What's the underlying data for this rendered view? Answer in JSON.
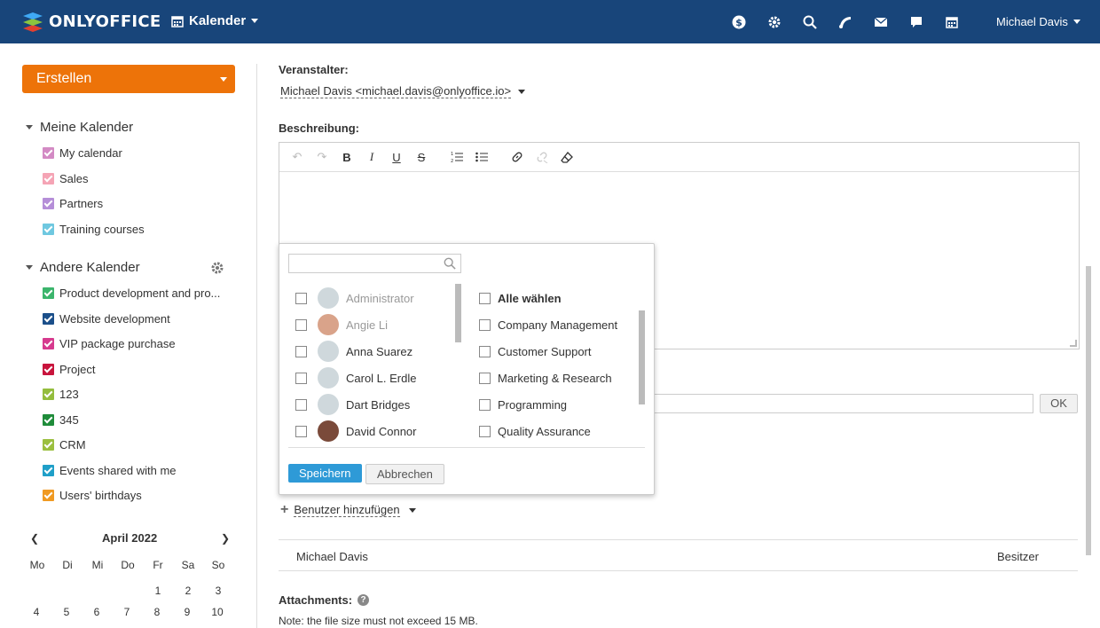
{
  "header": {
    "logo_text": "ONLYOFFICE",
    "module_label": "Kalender",
    "user_name": "Michael Davis",
    "icons": [
      "dollar-icon",
      "gear-icon",
      "search-icon",
      "feed-icon",
      "mail-icon",
      "chat-icon",
      "calendar-icon"
    ]
  },
  "sidebar": {
    "create_label": "Erstellen",
    "my_calendars_title": "Meine Kalender",
    "my_calendars": [
      {
        "label": "My calendar",
        "color": "#d38ac4"
      },
      {
        "label": "Sales",
        "color": "#f5a4b5"
      },
      {
        "label": "Partners",
        "color": "#b58ed8"
      },
      {
        "label": "Training courses",
        "color": "#6fc8e0"
      }
    ],
    "other_calendars_title": "Andere Kalender",
    "other_calendars": [
      {
        "label": "Product development and pro...",
        "color": "#3bb56c"
      },
      {
        "label": "Website development",
        "color": "#1b4f8a"
      },
      {
        "label": "VIP package purchase",
        "color": "#d63a8e"
      },
      {
        "label": "Project",
        "color": "#c8143c"
      },
      {
        "label": "123",
        "color": "#94bd3d"
      },
      {
        "label": "345",
        "color": "#1f8c3a"
      },
      {
        "label": "CRM",
        "color": "#9bbf3f"
      },
      {
        "label": "Events shared with me",
        "color": "#1f9fc8"
      },
      {
        "label": "Users' birthdays",
        "color": "#f09a22"
      }
    ],
    "mini_calendar": {
      "month": "April",
      "year": "2022",
      "day_names": [
        "Mo",
        "Di",
        "Mi",
        "Do",
        "Fr",
        "Sa",
        "So"
      ],
      "week1": [
        "",
        "",
        "",
        "",
        "1",
        "2",
        "3"
      ],
      "week2": [
        "4",
        "5",
        "6",
        "7",
        "8",
        "9",
        "10"
      ]
    }
  },
  "main": {
    "organizer_label": "Veranstalter:",
    "organizer_value": "Michael Davis <michael.davis@onlyoffice.io>",
    "description_label": "Beschreibung:",
    "ok_label": "OK",
    "add_user_label": "Benutzer hinzufügen",
    "participant_name": "Michael Davis",
    "participant_role": "Besitzer",
    "attachments_label": "Attachments:",
    "attachments_note": "Note: the file size must not exceed 15 MB."
  },
  "popup": {
    "search_placeholder": "",
    "users": [
      {
        "name": "Administrator",
        "dim": true,
        "avatar": "#cfd8dc"
      },
      {
        "name": "Angie Li",
        "dim": true,
        "avatar": "#d9a38a"
      },
      {
        "name": "Anna Suarez",
        "dim": false,
        "avatar": "#cfd8dc"
      },
      {
        "name": "Carol L. Erdle",
        "dim": false,
        "avatar": "#cfd8dc"
      },
      {
        "name": "Dart Bridges",
        "dim": false,
        "avatar": "#cfd8dc"
      },
      {
        "name": "David Connor",
        "dim": false,
        "avatar": "#7a4a3a"
      }
    ],
    "groups_select_all": "Alle wählen",
    "groups": [
      "Company Management",
      "Customer Support",
      "Marketing & Research",
      "Programming",
      "Quality Assurance"
    ],
    "save_label": "Speichern",
    "cancel_label": "Abbrechen"
  }
}
